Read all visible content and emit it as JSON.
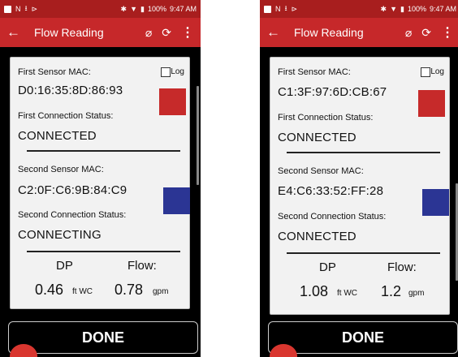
{
  "status_bar": {
    "battery": "100%",
    "time": "9:47 AM"
  },
  "app_bar": {
    "title": "Flow Reading"
  },
  "labels": {
    "first_mac": "First Sensor MAC:",
    "first_status": "First Connection Status:",
    "second_mac": "Second Sensor MAC:",
    "second_status": "Second Connection Status:",
    "log": "Log",
    "dp": "DP",
    "flow": "Flow:",
    "dp_unit": "ft WC",
    "flow_unit": "gpm"
  },
  "done_label": "DONE",
  "colors": {
    "app_bar": "#c6282a",
    "status_bar": "#a81e1e",
    "sensor1": "#c62a2a",
    "sensor2": "#2b3594"
  },
  "icons": [
    "back-arrow-icon",
    "no-signal-icon",
    "refresh-icon",
    "overflow-menu-icon"
  ],
  "screens": [
    {
      "first_mac": "D0:16:35:8D:86:93",
      "first_status": "CONNECTED",
      "second_mac": "C2:0F:C6:9B:84:C9",
      "second_status": "CONNECTING",
      "dp_value": "0.46",
      "flow_value": "0.78"
    },
    {
      "first_mac": "C1:3F:97:6D:CB:67",
      "first_status": "CONNECTED",
      "second_mac": "E4:C6:33:52:FF:28",
      "second_status": "CONNECTED",
      "dp_value": "1.08",
      "flow_value": "1.2"
    }
  ]
}
